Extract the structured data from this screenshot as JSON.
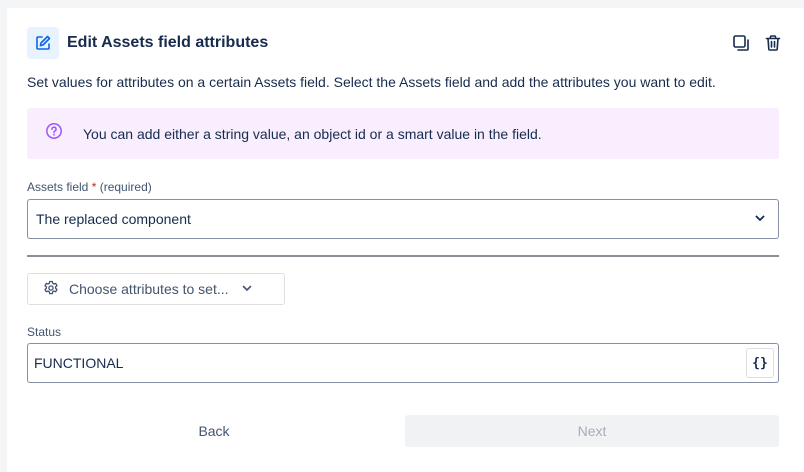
{
  "header": {
    "title": "Edit Assets field attributes",
    "icons": [
      "edit-icon",
      "copy-icon",
      "delete-icon"
    ]
  },
  "description": "Set values for attributes on a certain Assets field. Select the Assets field and add the attributes you want to edit.",
  "info_banner": {
    "icon": "help-circle-icon",
    "text": "You can add either a string value, an object id or a smart value in the field."
  },
  "assets_field": {
    "label": "Assets field",
    "required_star": "*",
    "required_text": "(required)",
    "value": "The replaced component"
  },
  "attributes": {
    "choose_label": "Choose attributes to set..."
  },
  "status_field": {
    "label": "Status",
    "value": "FUNCTIONAL",
    "smart_value_button": "{}"
  },
  "footer": {
    "back_label": "Back",
    "next_label": "Next"
  },
  "colors": {
    "accent": "#0c66e4",
    "info_bg": "#f8eefe",
    "info_icon": "#a054f7",
    "disabled_bg": "#f1f2f4",
    "disabled_text": "#a5adba"
  }
}
